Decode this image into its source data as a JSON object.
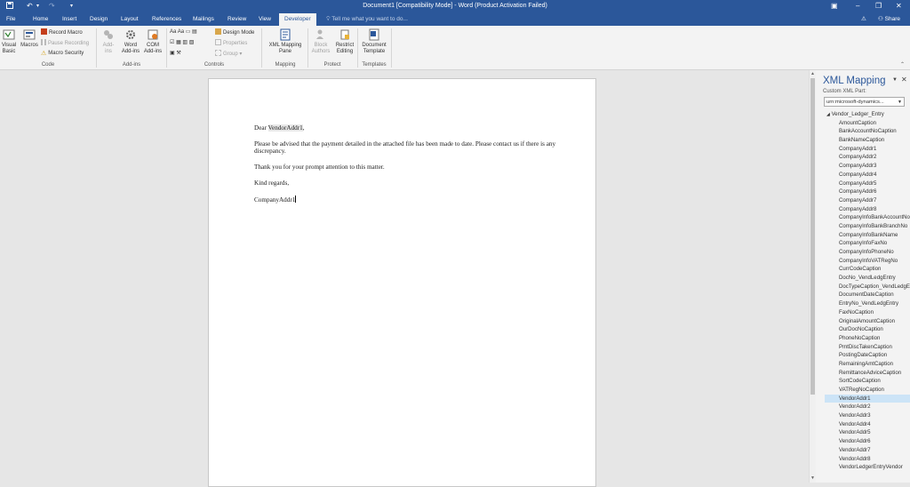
{
  "titlebar": {
    "title": "Document1 [Compatibility Mode] - Word (Product Activation Failed)",
    "save_icon": "save-icon",
    "undo_icon": "undo-icon",
    "redo_icon": "redo-icon",
    "customize_icon": "customize-qat-icon"
  },
  "tabs": [
    "File",
    "Home",
    "Insert",
    "Design",
    "Layout",
    "References",
    "Mailings",
    "Review",
    "View",
    "Developer"
  ],
  "active_tab": "Developer",
  "tell_me": "Tell me what you want to do...",
  "share_label": "Share",
  "ribbon": {
    "code": {
      "group": "Code",
      "visual_basic": "Visual Basic",
      "macros": "Macros",
      "record_macro": "Record Macro",
      "pause_recording": "Pause Recording",
      "macro_security": "Macro Security"
    },
    "addins": {
      "group": "Add-ins",
      "addins": "Add-ins",
      "word_addins": "Word Add-ins",
      "com_addins": "COM Add-ins"
    },
    "controls": {
      "group": "Controls",
      "design_mode": "Design Mode",
      "properties": "Properties",
      "group_btn": "Group"
    },
    "mapping": {
      "group": "Mapping",
      "xml_mapping_pane": "XML Mapping Pane"
    },
    "protect": {
      "group": "Protect",
      "block_authors": "Block Authors",
      "restrict_editing": "Restrict Editing"
    },
    "templates": {
      "group": "Templates",
      "document_template": "Document Template"
    }
  },
  "document": {
    "greeting_prefix": "Dear ",
    "greeting_field": "VendorAddr1",
    "greeting_suffix": ",",
    "paragraph1": "Please be advised that the payment detailed in the attached file has been made to date. Please contact us if there is any discrepancy.",
    "paragraph2": "Thank you for your prompt attention to this matter.",
    "closing": "Kind regards,",
    "signature_field": "CompanyAddr1"
  },
  "xml_pane": {
    "title": "XML Mapping",
    "custom_part_label": "Custom XML Part:",
    "custom_part_value": "urn:microsoft-dynamics...",
    "root": "Vendor_Ledger_Entry",
    "selected": "VendorAddr1",
    "nodes": [
      "AmountCaption",
      "BankAccountNoCaption",
      "BankNameCaption",
      "CompanyAddr1",
      "CompanyAddr2",
      "CompanyAddr3",
      "CompanyAddr4",
      "CompanyAddr5",
      "CompanyAddr6",
      "CompanyAddr7",
      "CompanyAddr8",
      "CompanyInfoBankAccountNo",
      "CompanyInfoBankBranchNo",
      "CompanyInfoBankName",
      "CompanyInfoFaxNo",
      "CompanyInfoPhoneNo",
      "CompanyInfoVATRegNo",
      "CurrCodeCaption",
      "DocNo_VendLedgEntry",
      "DocTypeCaption_VendLedgEntry",
      "DocumentDateCaption",
      "EntryNo_VendLedgEntry",
      "FaxNoCaption",
      "OriginalAmountCaption",
      "OurDocNoCaption",
      "PhoneNoCaption",
      "PmtDiscTakenCaption",
      "PostingDateCaption",
      "RemainingAmtCaption",
      "RemittanceAdviceCaption",
      "SortCodeCaption",
      "VATRegNoCaption",
      "VendorAddr1",
      "VendorAddr2",
      "VendorAddr3",
      "VendorAddr4",
      "VendorAddr5",
      "VendorAddr6",
      "VendorAddr7",
      "VendorAddr8",
      "VendorLedgerEntryVendor"
    ]
  },
  "colors": {
    "word_blue": "#2b579a",
    "ribbon_bg": "#f3f3f3",
    "selection": "#cce4f7",
    "field_shading": "#e8e8e8"
  }
}
